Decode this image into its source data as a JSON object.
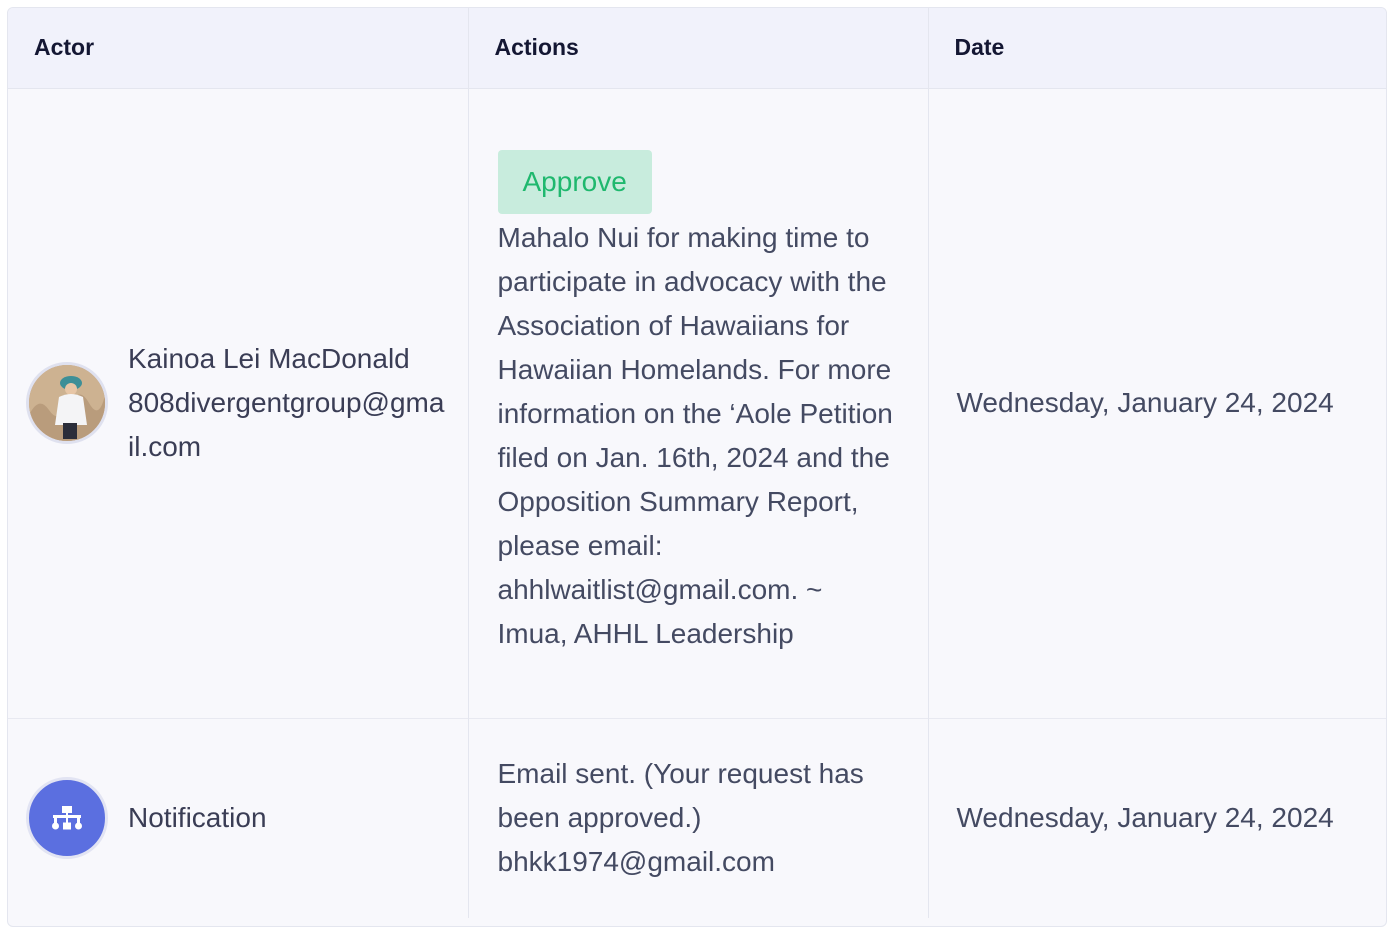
{
  "table": {
    "headers": [
      "Actor",
      "Actions",
      "Date"
    ],
    "rows": [
      {
        "actor_name": "Kainoa Lei MacDonald",
        "actor_email": "808divergentgroup@gmail.com",
        "avatar_icon": "user-photo-icon",
        "badge": "Approve",
        "action_text": "Mahalo Nui for making time to participate in advocacy with the Association of Hawaiians for Hawaiian Homelands. For more information on the ‘Aole Petition filed on Jan. 16th, 2024 and the Opposition Summary Report, please email: ahhlwaitlist@gmail.com. ~ Imua, AHHL Leadership",
        "date": "Wednesday, January 24, 2024"
      },
      {
        "actor_name": "Notification",
        "avatar_icon": "sitemap-icon",
        "action_text_1": "Email sent. (Your request has been approved.)",
        "action_text_2": "bhkk1974@gmail.com",
        "date": "Wednesday, January 24, 2024"
      }
    ]
  },
  "colors": {
    "header_bg": "#f1f2fb",
    "row_bg": "#f8f8fc",
    "badge_bg": "#c8ecdd",
    "badge_text": "#1fb86e",
    "notify_avatar": "#5b6fe0"
  }
}
